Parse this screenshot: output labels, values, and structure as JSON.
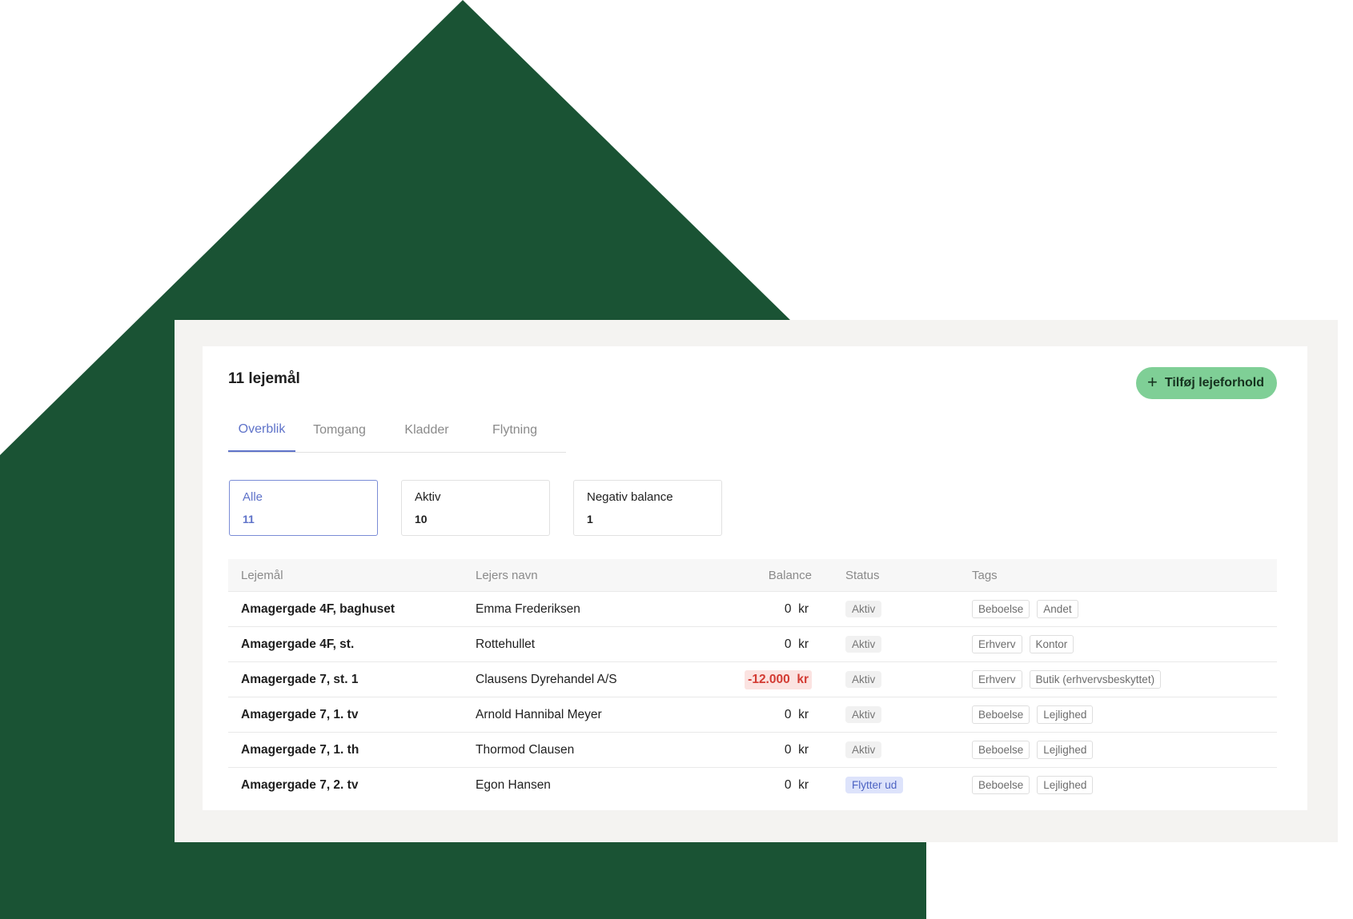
{
  "page": {
    "title": "11 lejemål",
    "add_button_label": "Tilføj lejeforhold"
  },
  "tabs": [
    {
      "label": "Overblik",
      "active": true
    },
    {
      "label": "Tomgang",
      "active": false
    },
    {
      "label": "Kladder",
      "active": false
    },
    {
      "label": "Flytning",
      "active": false
    }
  ],
  "filters": [
    {
      "label": "Alle",
      "count": "11",
      "active": true
    },
    {
      "label": "Aktiv",
      "count": "10",
      "active": false
    },
    {
      "label": "Negativ balance",
      "count": "1",
      "active": false
    }
  ],
  "table": {
    "columns": {
      "lease": "Lejemål",
      "tenant": "Lejers navn",
      "balance": "Balance",
      "status": "Status",
      "tags": "Tags"
    },
    "rows": [
      {
        "lease": "Amagergade 4F, baghuset",
        "tenant": "Emma Frederiksen",
        "balance": "0  kr",
        "status": "Aktiv",
        "tags": [
          "Beboelse",
          "Andet"
        ]
      },
      {
        "lease": "Amagergade 4F, st.",
        "tenant": "Rottehullet",
        "balance": "0  kr",
        "status": "Aktiv",
        "tags": [
          "Erhverv",
          "Kontor"
        ]
      },
      {
        "lease": "Amagergade 7, st. 1",
        "tenant": "Clausens Dyrehandel A/S",
        "balance": "-12.000  kr",
        "status": "Aktiv",
        "tags": [
          "Erhverv",
          "Butik (erhvervsbeskyttet)"
        ]
      },
      {
        "lease": "Amagergade 7, 1. tv",
        "tenant": "Arnold Hannibal Meyer",
        "balance": "0  kr",
        "status": "Aktiv",
        "tags": [
          "Beboelse",
          "Lejlighed"
        ]
      },
      {
        "lease": "Amagergade 7, 1. th",
        "tenant": "Thormod Clausen",
        "balance": "0  kr",
        "status": "Aktiv",
        "tags": [
          "Beboelse",
          "Lejlighed"
        ]
      },
      {
        "lease": "Amagergade 7, 2. tv",
        "tenant": "Egon Hansen",
        "balance": "0  kr",
        "status": "Flytter ud",
        "tags": [
          "Beboelse",
          "Lejlighed"
        ]
      }
    ]
  },
  "colors": {
    "house_green": "#1a5334",
    "accent_blue": "#5f73c9",
    "button_green": "#7fcf96",
    "negative_red": "#d33b33"
  }
}
